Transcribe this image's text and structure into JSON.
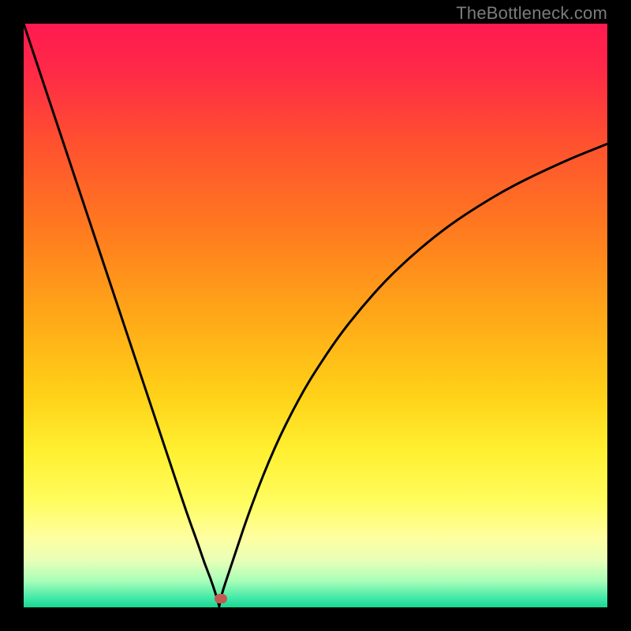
{
  "watermark": "TheBottleneck.com",
  "gradient_stops": [
    {
      "offset": 0,
      "color": "#ff1a50"
    },
    {
      "offset": 0.08,
      "color": "#ff2a48"
    },
    {
      "offset": 0.2,
      "color": "#ff5030"
    },
    {
      "offset": 0.35,
      "color": "#ff7a20"
    },
    {
      "offset": 0.5,
      "color": "#ffa818"
    },
    {
      "offset": 0.63,
      "color": "#ffd018"
    },
    {
      "offset": 0.73,
      "color": "#fff030"
    },
    {
      "offset": 0.82,
      "color": "#fffd60"
    },
    {
      "offset": 0.88,
      "color": "#ffffa0"
    },
    {
      "offset": 0.92,
      "color": "#e8ffb8"
    },
    {
      "offset": 0.955,
      "color": "#a8ffb8"
    },
    {
      "offset": 0.985,
      "color": "#40e8a8"
    },
    {
      "offset": 1.0,
      "color": "#18d890"
    }
  ],
  "plot": {
    "inner_w": 740,
    "inner_h": 740
  },
  "marker": {
    "x_frac": 0.338,
    "y_frac": 0.985
  },
  "chart_data": {
    "type": "line",
    "title": "",
    "xlabel": "",
    "ylabel": "",
    "xlim": [
      0,
      1
    ],
    "ylim": [
      0,
      1
    ],
    "x": [
      0.0,
      0.02,
      0.04,
      0.06,
      0.08,
      0.1,
      0.12,
      0.14,
      0.16,
      0.18,
      0.2,
      0.22,
      0.24,
      0.26,
      0.28,
      0.3,
      0.31,
      0.32,
      0.33,
      0.335,
      0.34,
      0.35,
      0.36,
      0.37,
      0.38,
      0.4,
      0.42,
      0.44,
      0.46,
      0.48,
      0.5,
      0.54,
      0.58,
      0.62,
      0.66,
      0.7,
      0.74,
      0.78,
      0.82,
      0.86,
      0.9,
      0.94,
      0.98,
      1.0
    ],
    "values": [
      1.0,
      0.94,
      0.88,
      0.82,
      0.76,
      0.7,
      0.64,
      0.58,
      0.52,
      0.46,
      0.4,
      0.34,
      0.28,
      0.22,
      0.16,
      0.105,
      0.075,
      0.05,
      0.02,
      0.002,
      0.025,
      0.055,
      0.085,
      0.115,
      0.145,
      0.2,
      0.25,
      0.295,
      0.335,
      0.372,
      0.405,
      0.465,
      0.515,
      0.56,
      0.598,
      0.632,
      0.662,
      0.688,
      0.712,
      0.733,
      0.752,
      0.77,
      0.786,
      0.794
    ],
    "marker_point": {
      "x": 0.338,
      "y": 0.015
    }
  }
}
